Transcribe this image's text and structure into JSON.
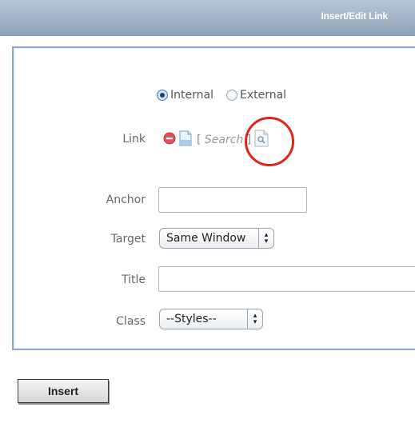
{
  "dialog": {
    "title": "Insert/Edit Link"
  },
  "link_type": {
    "options": [
      {
        "label": "Internal",
        "checked": true
      },
      {
        "label": "External",
        "checked": false
      }
    ]
  },
  "link": {
    "label": "Link",
    "search_open": "[",
    "search_text": "Search",
    "search_close": "]",
    "icons": [
      "remove-icon",
      "page-icon",
      "browse-page-icon"
    ]
  },
  "anchor": {
    "label": "Anchor",
    "value": ""
  },
  "target": {
    "label": "Target",
    "selected": "Same Window"
  },
  "title_field": {
    "label": "Title",
    "value": ""
  },
  "class_field": {
    "label": "Class",
    "selected": "--Styles--"
  },
  "actions": {
    "insert_label": "Insert"
  },
  "colors": {
    "titlebar": "#8ea3b8",
    "panel_border": "#8aa7c6",
    "highlight": "#e2231a",
    "remove_icon": "#e0505a"
  }
}
